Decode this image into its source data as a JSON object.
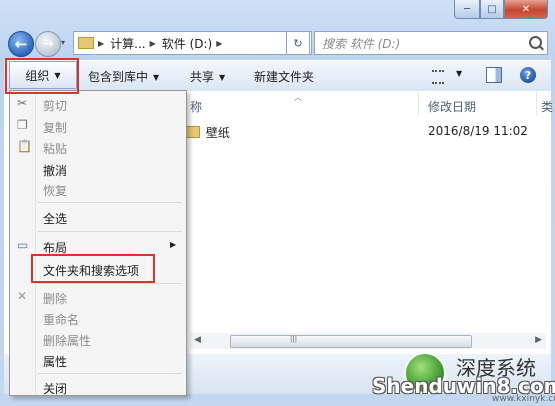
{
  "window": {
    "caption_buttons": {
      "minimize": "─",
      "maximize": "□",
      "close": "✕"
    }
  },
  "nav": {
    "back_glyph": "←",
    "forward_glyph": "→",
    "dropdown_glyph": "▾"
  },
  "address_bar": {
    "segments": [
      "计算...",
      "软件 (D:)"
    ],
    "separator": "▶",
    "dropdown_glyph": "▾",
    "refresh_glyph": "↻"
  },
  "search": {
    "placeholder": "搜索 软件 (D:)"
  },
  "command_bar": {
    "organize": "组织",
    "include_in_library": "包含到库中",
    "share": "共享",
    "new_folder": "新建文件夹",
    "dropdown_glyph": "▼",
    "help_glyph": "?"
  },
  "file_list": {
    "columns": {
      "name": "名称",
      "name_visible": "称",
      "date_modified": "修改日期",
      "extra": "类"
    },
    "rows": [
      {
        "name": "壁纸",
        "date": "2016/8/19 11:02"
      }
    ]
  },
  "organize_menu": {
    "items": [
      {
        "label": "剪切",
        "enabled": false
      },
      {
        "label": "复制",
        "enabled": false
      },
      {
        "label": "粘贴",
        "enabled": false
      },
      {
        "label": "撤消",
        "enabled": true
      },
      {
        "label": "恢复",
        "enabled": false
      },
      {
        "label": "全选",
        "enabled": true
      },
      {
        "label": "布局",
        "enabled": true
      },
      {
        "label": "文件夹和搜索选项",
        "enabled": true
      },
      {
        "label": "删除",
        "enabled": false
      },
      {
        "label": "重命名",
        "enabled": false
      },
      {
        "label": "删除属性",
        "enabled": false
      },
      {
        "label": "属性",
        "enabled": true
      },
      {
        "label": "关闭",
        "enabled": true
      }
    ],
    "submenu_glyph": "▶"
  },
  "highlight_color": "#d9342c",
  "watermark": {
    "brand_cn": "深度系统",
    "brand_en": "Shenduwin8.com",
    "url": "www.kxinyk.com"
  }
}
